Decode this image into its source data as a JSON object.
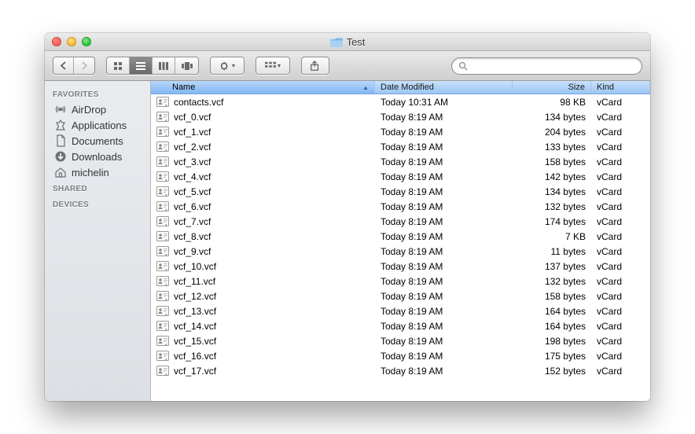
{
  "window": {
    "title": "Test"
  },
  "search": {
    "placeholder": ""
  },
  "sidebar": {
    "sections": [
      {
        "label": "FAVORITES",
        "items": [
          {
            "icon": "airdrop",
            "label": "AirDrop"
          },
          {
            "icon": "apps",
            "label": "Applications"
          },
          {
            "icon": "docs",
            "label": "Documents"
          },
          {
            "icon": "downloads",
            "label": "Downloads"
          },
          {
            "icon": "home",
            "label": "michelin"
          }
        ]
      },
      {
        "label": "SHARED",
        "items": []
      },
      {
        "label": "DEVICES",
        "items": []
      }
    ]
  },
  "columns": {
    "name": "Name",
    "date": "Date Modified",
    "size": "Size",
    "kind": "Kind"
  },
  "files": [
    {
      "name": "contacts.vcf",
      "date": "Today 10:31 AM",
      "size": "98 KB",
      "kind": "vCard"
    },
    {
      "name": "vcf_0.vcf",
      "date": "Today 8:19 AM",
      "size": "134 bytes",
      "kind": "vCard"
    },
    {
      "name": "vcf_1.vcf",
      "date": "Today 8:19 AM",
      "size": "204 bytes",
      "kind": "vCard"
    },
    {
      "name": "vcf_2.vcf",
      "date": "Today 8:19 AM",
      "size": "133 bytes",
      "kind": "vCard"
    },
    {
      "name": "vcf_3.vcf",
      "date": "Today 8:19 AM",
      "size": "158 bytes",
      "kind": "vCard"
    },
    {
      "name": "vcf_4.vcf",
      "date": "Today 8:19 AM",
      "size": "142 bytes",
      "kind": "vCard"
    },
    {
      "name": "vcf_5.vcf",
      "date": "Today 8:19 AM",
      "size": "134 bytes",
      "kind": "vCard"
    },
    {
      "name": "vcf_6.vcf",
      "date": "Today 8:19 AM",
      "size": "132 bytes",
      "kind": "vCard"
    },
    {
      "name": "vcf_7.vcf",
      "date": "Today 8:19 AM",
      "size": "174 bytes",
      "kind": "vCard"
    },
    {
      "name": "vcf_8.vcf",
      "date": "Today 8:19 AM",
      "size": "7 KB",
      "kind": "vCard"
    },
    {
      "name": "vcf_9.vcf",
      "date": "Today 8:19 AM",
      "size": "11 bytes",
      "kind": "vCard"
    },
    {
      "name": "vcf_10.vcf",
      "date": "Today 8:19 AM",
      "size": "137 bytes",
      "kind": "vCard"
    },
    {
      "name": "vcf_11.vcf",
      "date": "Today 8:19 AM",
      "size": "132 bytes",
      "kind": "vCard"
    },
    {
      "name": "vcf_12.vcf",
      "date": "Today 8:19 AM",
      "size": "158 bytes",
      "kind": "vCard"
    },
    {
      "name": "vcf_13.vcf",
      "date": "Today 8:19 AM",
      "size": "164 bytes",
      "kind": "vCard"
    },
    {
      "name": "vcf_14.vcf",
      "date": "Today 8:19 AM",
      "size": "164 bytes",
      "kind": "vCard"
    },
    {
      "name": "vcf_15.vcf",
      "date": "Today 8:19 AM",
      "size": "198 bytes",
      "kind": "vCard"
    },
    {
      "name": "vcf_16.vcf",
      "date": "Today 8:19 AM",
      "size": "175 bytes",
      "kind": "vCard"
    },
    {
      "name": "vcf_17.vcf",
      "date": "Today 8:19 AM",
      "size": "152 bytes",
      "kind": "vCard"
    }
  ]
}
